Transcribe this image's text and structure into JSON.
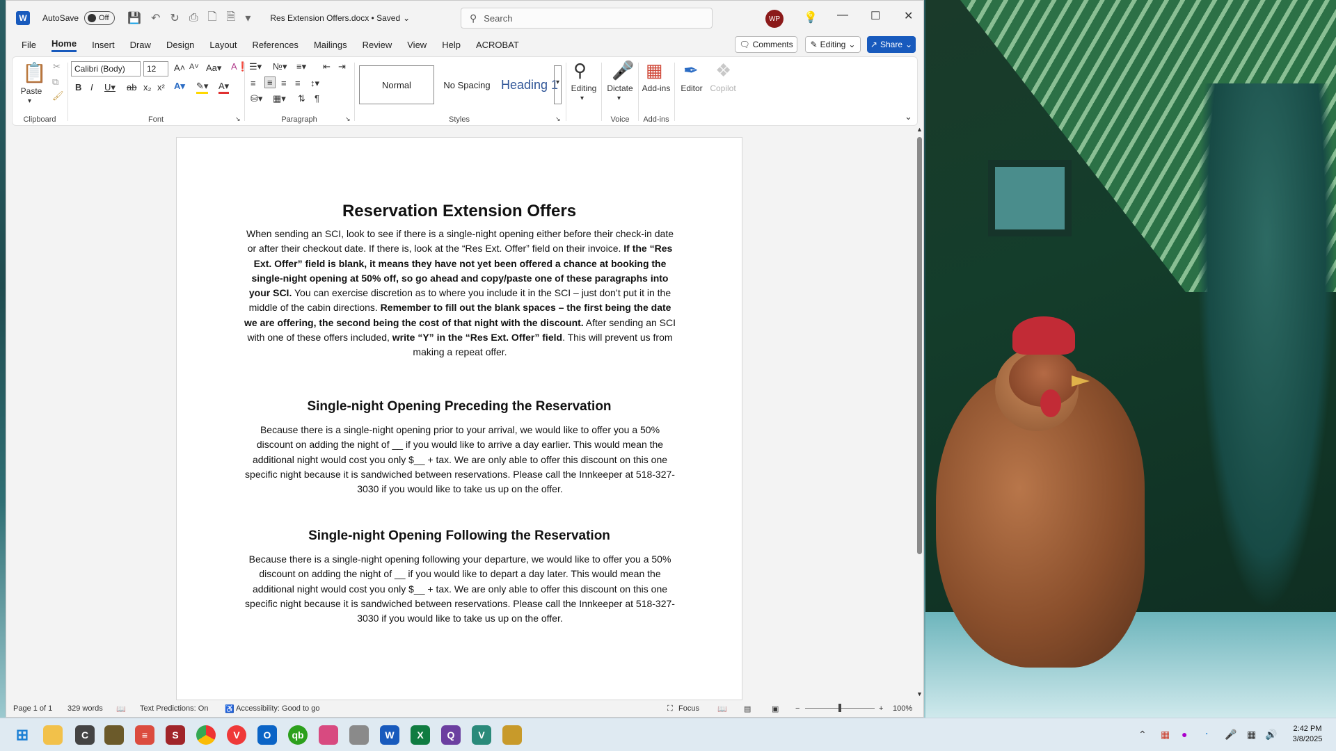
{
  "app": {
    "title": "Res Extension Offers.docx • Saved",
    "autosave_label": "AutoSave",
    "autosave_state": "Off",
    "search_placeholder": "Search",
    "user_initials": "WP"
  },
  "tabs": [
    "File",
    "Home",
    "Insert",
    "Draw",
    "Design",
    "Layout",
    "References",
    "Mailings",
    "Review",
    "View",
    "Help",
    "ACROBAT"
  ],
  "right_buttons": {
    "comments": "Comments",
    "editing": "Editing",
    "share": "Share"
  },
  "ribbon": {
    "clipboard": {
      "paste": "Paste",
      "label": "Clipboard"
    },
    "font": {
      "name": "Calibri (Body)",
      "size": "12",
      "label": "Font"
    },
    "paragraph": {
      "label": "Paragraph"
    },
    "styles": {
      "normal": "Normal",
      "no_spacing": "No Spacing",
      "heading1": "Heading 1",
      "label": "Styles"
    },
    "editing": {
      "label": "Editing"
    },
    "voice": {
      "dictate": "Dictate",
      "label": "Voice"
    },
    "addins": {
      "addins": "Add-ins",
      "label": "Add-ins"
    },
    "editor": "Editor",
    "copilot": "Copilot"
  },
  "document": {
    "title": "Reservation Extension Offers",
    "intro_parts": [
      {
        "text": "When sending an SCI, look to see if there is a single-night opening either before their check-in date or after their checkout date. If there is, look at the “Res Ext. Offer” field on their invoice. ",
        "bold": false
      },
      {
        "text": "If the “Res Ext. Offer” field is blank, it means they have not yet been offered a chance at booking the single-night opening at 50% off, so go ahead and copy/paste one of these paragraphs into your SCI.",
        "bold": true
      },
      {
        "text": " You can exercise discretion as to where you include it in the SCI – just don’t put it in the middle of the cabin directions. ",
        "bold": false
      },
      {
        "text": "Remember to fill out the blank spaces – the first being the date we are offering, the second being the cost of that night with the discount.",
        "bold": true
      },
      {
        "text": " After sending an SCI with one of these offers included, ",
        "bold": false
      },
      {
        "text": "write “Y” in the “Res Ext. Offer” field",
        "bold": true
      },
      {
        "text": ". This will prevent us from making a repeat offer.",
        "bold": false
      }
    ],
    "section1_heading": "Single-night Opening Preceding the Reservation",
    "section1_body": "Because there is a single-night opening prior to your arrival, we would like to offer you a 50% discount on adding the night of __ if you would like to arrive a day earlier. This would mean the additional night would cost you only $__ + tax.    We are only able to offer this discount on this one specific night because it is sandwiched between reservations. Please call the Innkeeper at 518-327-3030 if you would like to take us up on the offer.",
    "section2_heading": "Single-night Opening Following the Reservation",
    "section2_body": "Because there is a single-night opening following your departure, we would like to offer you a 50% discount on adding the night of __ if you would like to depart a day later. This would mean the additional night would cost you only $__ + tax.  We are only able to offer this discount on this one specific night because it is sandwiched between reservations. Please call the Innkeeper at 518-327-3030 if you would like to take us up on the offer."
  },
  "status": {
    "page": "Page 1 of 1",
    "words": "329 words",
    "text_predictions": "Text Predictions: On",
    "accessibility": "Accessibility: Good to go",
    "focus": "Focus",
    "zoom": "100%"
  },
  "clock": {
    "time": "2:42 PM",
    "date": "3/8/2025"
  },
  "colors": {
    "accent": "#185abd",
    "avatar": "#8b1a1a"
  }
}
